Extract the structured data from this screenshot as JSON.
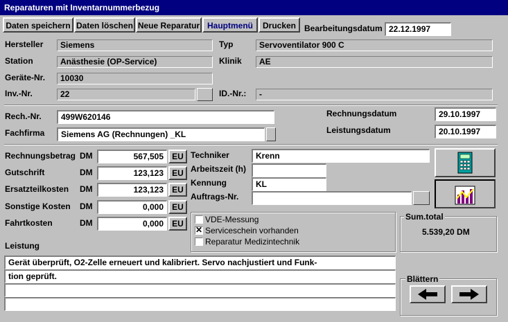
{
  "window": {
    "title": "Reparaturen mit Inventarnummerbezug"
  },
  "toolbar": {
    "save": "Daten speichern",
    "delete": "Daten löschen",
    "new": "Neue Reparatur",
    "main_menu": "Hauptmenü",
    "print": "Drucken",
    "edit_date_label": "Bearbeitungsdatum",
    "edit_date_value": "22.12.1997"
  },
  "device": {
    "hersteller_label": "Hersteller",
    "hersteller": "Siemens",
    "typ_label": "Typ",
    "typ": "Servoventilator 900 C",
    "station_label": "Station",
    "station": "Anästhesie (OP-Service)",
    "klinik_label": "Klinik",
    "klinik": "AE",
    "geraete_label": "Geräte-Nr.",
    "geraete": "10030",
    "inv_label": "Inv.-Nr.",
    "inv": "22",
    "id_label": "ID.-Nr.:",
    "id": "-"
  },
  "invoice": {
    "rech_label": "Rech.-Nr.",
    "rech": "499W620146",
    "fachfirma_label": "Fachfirma",
    "fachfirma": "Siemens AG (Rechnungen) _KL",
    "rechnungsdatum_label": "Rechnungsdatum",
    "rechnungsdatum": "29.10.1997",
    "leistungsdatum_label": "Leistungsdatum",
    "leistungsdatum": "20.10.1997"
  },
  "costs": {
    "currency": "DM",
    "eu": "EU",
    "rows": [
      {
        "label": "Rechnungsbetrag",
        "value": "567,505"
      },
      {
        "label": "Gutschrift",
        "value": "123,123"
      },
      {
        "label": "Ersatzteilkosten",
        "value": "123,123"
      },
      {
        "label": "Sonstige Kosten",
        "value": "0,000"
      },
      {
        "label": "Fahrtkosten",
        "value": "0,000"
      }
    ]
  },
  "tech": {
    "techniker_label": "Techniker",
    "techniker": "Krenn",
    "arbeitszeit_label": "Arbeitszeit (h)",
    "arbeitszeit": "",
    "kennung_label": "Kennung",
    "kennung": "KL",
    "auftrag_label": "Auftrags-Nr.",
    "auftrag": ""
  },
  "checks": {
    "vde": "VDE-Messung",
    "vde_checked": false,
    "service": "Serviceschein vorhanden",
    "service_checked": true,
    "med": "Reparatur Medizintechnik",
    "med_checked": false,
    "mark": "✕"
  },
  "sum": {
    "label": "Sum.total",
    "value": "5.539,20 DM"
  },
  "leistung": {
    "label": "Leistung",
    "lines": [
      "Gerät überprüft, O2-Zelle erneuert und kalibriert. Servo nachjustiert und Funk-",
      "tion geprüft.",
      "",
      ""
    ]
  },
  "blaettern": {
    "label": "Blättern"
  },
  "colors": {
    "titlebar": "#000080",
    "face": "#c0c0c0",
    "accent_text": "#000080"
  }
}
